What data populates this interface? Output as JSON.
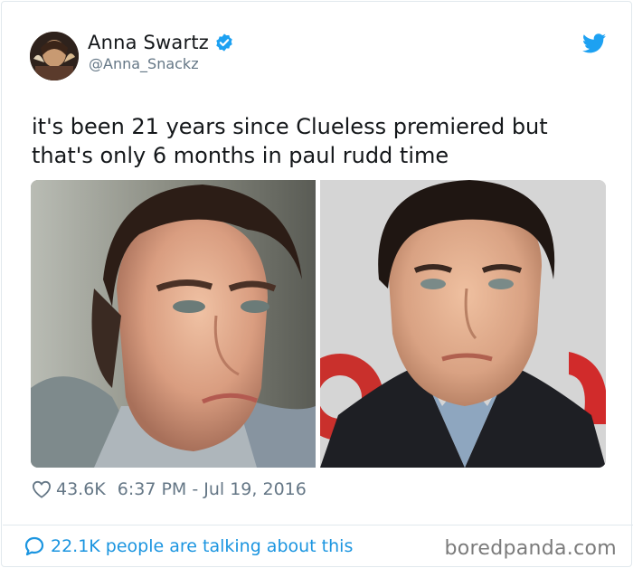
{
  "tweet": {
    "display_name": "Anna Swartz",
    "handle": "@Anna_Snackz",
    "text": "it's been 21 years since Clueless premiered but that's only 6 months in paul rudd time",
    "likes": "43.6K",
    "timestamp": "6:37 PM - Jul 19, 2016",
    "talking": "22.1K people are talking about this"
  },
  "watermark": "boredpanda.com",
  "icons": {
    "verified": "verified-badge-icon",
    "twitter": "twitter-bird-icon",
    "like": "heart-icon",
    "reply": "speech-bubble-icon"
  },
  "colors": {
    "twitter_blue": "#1da1f2",
    "link_blue": "#1b95e0",
    "text": "#14171a",
    "secondary": "#657786"
  }
}
